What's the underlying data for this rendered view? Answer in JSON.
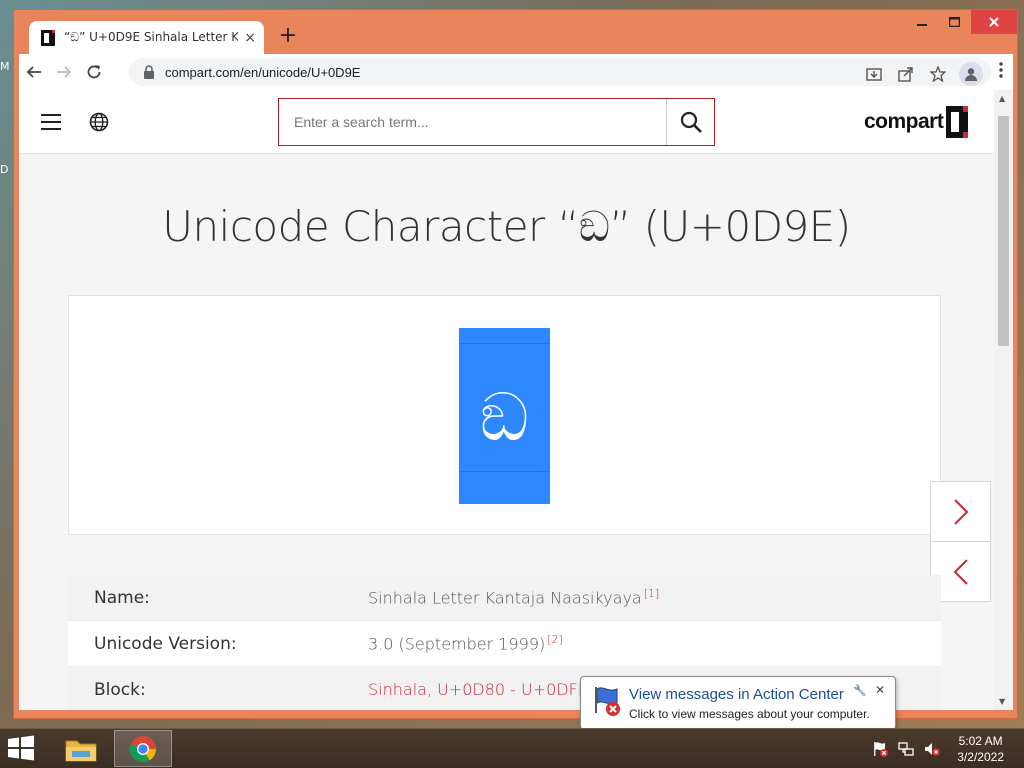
{
  "desktop": {
    "left_edge_letters": [
      "M",
      "D"
    ]
  },
  "browser": {
    "tab_title": "“ඞ” U+0D9E Sinhala Letter Kantaja Naasikyaya",
    "tab_close": "×",
    "new_tab": "+",
    "url": "compart.com/en/unicode/U+0D9E",
    "window_controls": {
      "minimize": "🗕",
      "maximize": "🗖",
      "close": "✕"
    }
  },
  "site": {
    "search_placeholder": "Enter a search term...",
    "logo_text": "compart",
    "page_title": "Unicode Character “ඞ” (U+0D9E)",
    "glyph": "ඞ",
    "info_rows": [
      {
        "key": "Name:",
        "value": "Sinhala Letter Kantaja Naasikyaya",
        "ref": "[1]",
        "link": false
      },
      {
        "key": "Unicode Version:",
        "value": "3.0 (September 1999)",
        "ref": "[2]",
        "link": false
      },
      {
        "key": "Block:",
        "value": "Sinhala, U+0D80 - U+0DFF",
        "ref": "",
        "link": true
      }
    ]
  },
  "notification": {
    "title": "View messages in Action Center",
    "text": "Click to view messages about your computer."
  },
  "taskbar": {
    "time": "5:02 AM",
    "date": "3/2/2022"
  },
  "colors": {
    "window_frame": "#e9855b",
    "accent_red": "#c8283a",
    "glyph_tile": "#2d88ff"
  }
}
